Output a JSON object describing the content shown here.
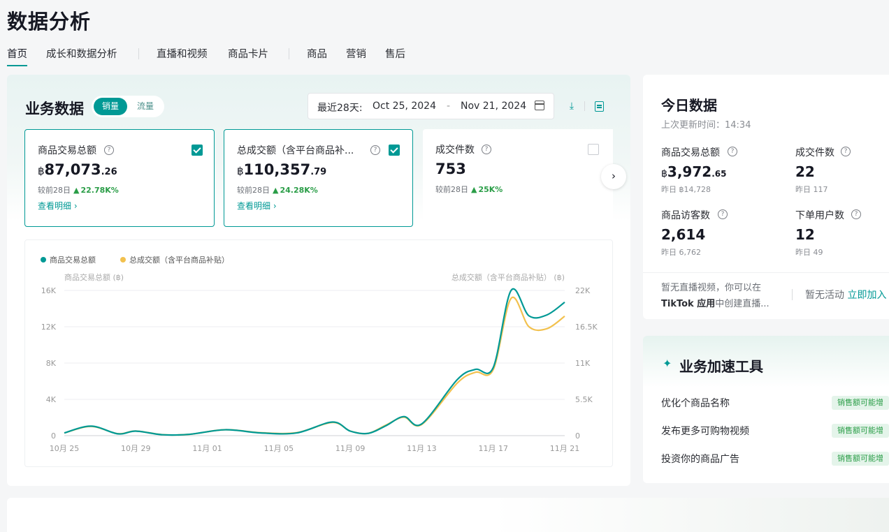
{
  "page": {
    "title": "数据分析"
  },
  "tabs": [
    "首页",
    "成长和数据分析",
    "直播和视频",
    "商品卡片",
    "商品",
    "营销",
    "售后"
  ],
  "business": {
    "title": "业务数据",
    "toggle": {
      "on": "销量",
      "off": "流量"
    },
    "date": {
      "label": "最近28天:",
      "start": "Oct 25, 2024",
      "dash": "-",
      "end": "Nov 21, 2024"
    },
    "icons": {
      "download": "download-icon",
      "report": "report-icon",
      "calendar": "calendar-icon"
    }
  },
  "metrics": [
    {
      "label": "商品交易总额",
      "currency": "฿",
      "value": "87,073",
      "decimals": ".26",
      "compare_label": "较前28日",
      "change": "22.78K%",
      "link": "查看明细 ›",
      "selected": true
    },
    {
      "label": "总成交额（含平台商品补...",
      "currency": "฿",
      "value": "110,357",
      "decimals": ".79",
      "compare_label": "较前28日",
      "change": "24.28K%",
      "link": "查看明细 ›",
      "selected": true
    },
    {
      "label": "成交件数",
      "currency": "",
      "value": "753",
      "decimals": "",
      "compare_label": "较前28日",
      "change": "25K%",
      "link": "",
      "selected": false
    }
  ],
  "chart_data": {
    "type": "line",
    "legend": [
      "商品交易总额",
      "总成交额（含平台商品补贴）"
    ],
    "legend_placement": "top-left",
    "ylabel_left": "商品交易总额 (฿)",
    "ylabel_right": "总成交额（含平台商品补贴） (฿)",
    "left_ticks": [
      "0",
      "4K",
      "8K",
      "12K",
      "16K"
    ],
    "right_ticks": [
      "0",
      "5.5K",
      "11K",
      "16.5K",
      "22K"
    ],
    "ylim_left": [
      0,
      16000
    ],
    "ylim_right": [
      0,
      22000
    ],
    "x_ticks": [
      "10月 25",
      "10月 29",
      "11月 01",
      "11月 05",
      "11月 09",
      "11月 13",
      "11月 17",
      "11月 21"
    ],
    "x_tick_index": [
      0,
      4,
      8,
      12,
      16,
      20,
      24,
      28
    ],
    "grid": true,
    "colors": {
      "series1": "#009995",
      "series2": "#f2c14e"
    },
    "series": [
      {
        "name": "商品交易总额",
        "axis": "left",
        "x": [
          0,
          1.5,
          3,
          4,
          5.5,
          7,
          9,
          11,
          13,
          15,
          16,
          17,
          18,
          19,
          20,
          22,
          23,
          24,
          25,
          26,
          27,
          28
        ],
        "values": [
          300,
          1050,
          200,
          500,
          100,
          150,
          650,
          300,
          300,
          1500,
          500,
          250,
          1100,
          2100,
          1300,
          6200,
          7300,
          7500,
          16000,
          13200,
          13300,
          14700
        ]
      },
      {
        "name": "总成交额（含平台商品补贴）",
        "axis": "right",
        "x": [
          0,
          1.5,
          3,
          4,
          5.5,
          7,
          9,
          11,
          13,
          15,
          16,
          17,
          18,
          19,
          20,
          22,
          23,
          24,
          25,
          26,
          27,
          28
        ],
        "values": [
          400,
          1400,
          300,
          700,
          150,
          200,
          900,
          450,
          450,
          2000,
          700,
          350,
          1600,
          2800,
          1700,
          8000,
          9600,
          10000,
          20800,
          16500,
          16200,
          18100
        ]
      }
    ]
  },
  "today": {
    "title": "今日数据",
    "updated": "上次更新时间：14:34",
    "items": [
      {
        "label": "商品交易总额",
        "currency": "฿",
        "value": "3,972",
        "decimals": ".65",
        "yesterday": "昨日 ฿14,728"
      },
      {
        "label": "成交件数",
        "currency": "",
        "value": "22",
        "decimals": "",
        "yesterday": "昨日 117"
      },
      {
        "label": "商品访客数",
        "currency": "",
        "value": "2,614",
        "decimals": "",
        "yesterday": "昨日 6,762"
      },
      {
        "label": "下单用户数",
        "currency": "",
        "value": "12",
        "decimals": "",
        "yesterday": "昨日 49"
      }
    ],
    "live_text_1": "暂无直播视频，你可以在",
    "live_text_2_bold": "TikTok 应用",
    "live_text_2": "中创建直播...",
    "activity_text": "暂无活动",
    "activity_link": "立即加入"
  },
  "tools": {
    "title": "业务加速工具",
    "items": [
      {
        "label": "优化个商品名称",
        "badge": "销售额可能增"
      },
      {
        "label": "发布更多可购物视频",
        "badge": "销售额可能增"
      },
      {
        "label": "投资你的商品广告",
        "badge": "销售额可能增"
      }
    ]
  }
}
